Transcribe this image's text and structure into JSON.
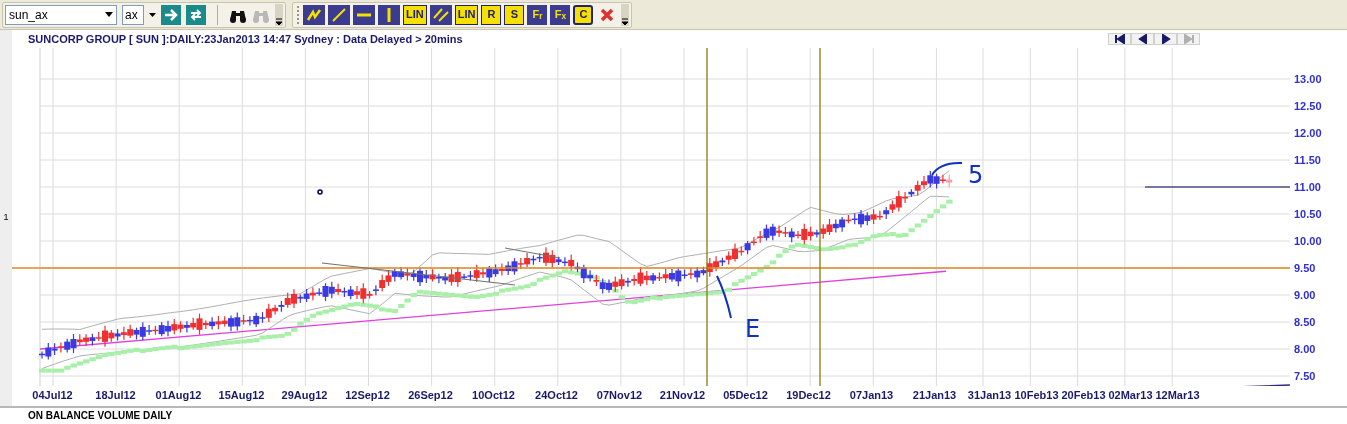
{
  "toolbar": {
    "symbol": "sun_ax",
    "exchange": "ax",
    "tools": [
      {
        "kind": "zigzag"
      },
      {
        "kind": "line"
      },
      {
        "kind": "hline"
      },
      {
        "kind": "vline"
      },
      {
        "kind": "tag",
        "label": "LIN"
      },
      {
        "kind": "parallel"
      },
      {
        "kind": "tag",
        "label": "LIN"
      },
      {
        "kind": "tag",
        "label": "R"
      },
      {
        "kind": "tag",
        "label": "S"
      },
      {
        "kind": "formula",
        "label": "F$_{r}$"
      },
      {
        "kind": "formula",
        "label": "F$_{x}$"
      },
      {
        "kind": "boxed",
        "label": "C"
      },
      {
        "kind": "delete"
      }
    ]
  },
  "chart": {
    "title": "SUNCORP GROUP [ SUN ]:DAILY:23Jan2013 14:47 Sydney : Data Delayed > 20mins",
    "pane_label": "1",
    "nav_buttons": [
      {
        "kind": "first",
        "disabled": false
      },
      {
        "kind": "prev",
        "disabled": false
      },
      {
        "kind": "next",
        "disabled": false
      },
      {
        "kind": "last",
        "disabled": true
      }
    ],
    "y_axis": [
      "13.00",
      "12.50",
      "12.00",
      "11.50",
      "11.00",
      "10.50",
      "10.00",
      "9.50",
      "9.00",
      "8.50",
      "8.00",
      "7.50"
    ],
    "x_axis": [
      "04Jul12",
      "18Jul12",
      "01Aug12",
      "15Aug12",
      "29Aug12",
      "12Sep12",
      "26Sep12",
      "10Oct12",
      "24Oct12",
      "07Nov12",
      "21Nov12",
      "05Dec12",
      "19Dec12",
      "07Jan13",
      "21Jan13",
      "31Jan13",
      "10Feb13",
      "20Feb13",
      "02Mar13",
      "12Mar13"
    ],
    "pen_notes": [
      "E",
      "5"
    ]
  },
  "lower_pane": {
    "title": "ON BALANCE VOLUME DAILY"
  }
}
